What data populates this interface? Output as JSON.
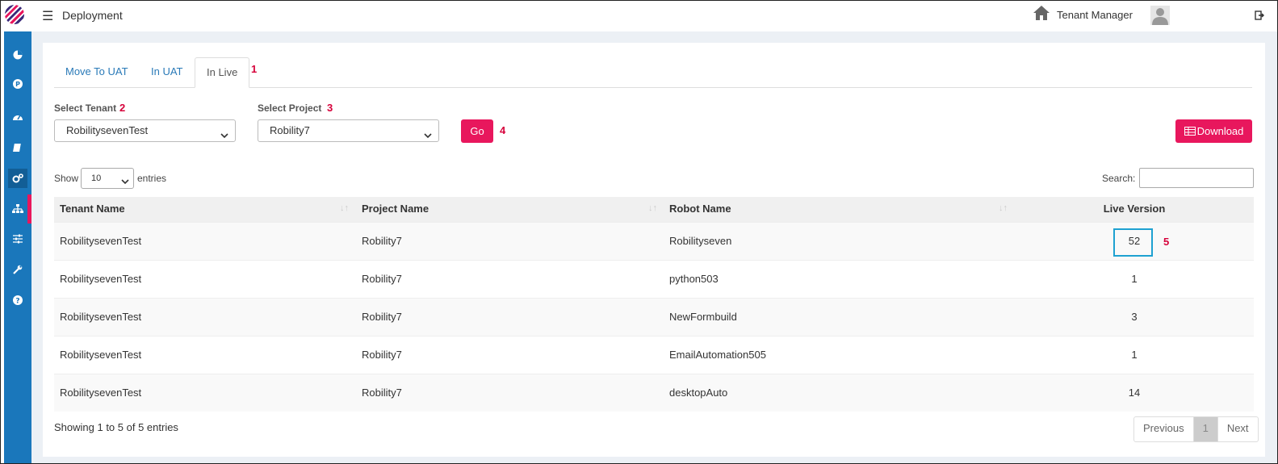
{
  "header": {
    "title": "Deployment",
    "tenant_manager": "Tenant Manager"
  },
  "sidebar": {
    "items": [
      {
        "icon": "pie-chart-icon"
      },
      {
        "icon": "p-circle-icon"
      },
      {
        "icon": "dashboard-gauge-icon"
      },
      {
        "icon": "book-icon"
      },
      {
        "icon": "gears-icon"
      },
      {
        "icon": "sitemap-icon"
      },
      {
        "icon": "sliders-icon"
      },
      {
        "icon": "wrench-icon"
      },
      {
        "icon": "help-icon"
      }
    ],
    "active_color": "#e8175d",
    "bg_color": "#1a77bb"
  },
  "tabs": [
    {
      "label": "Move To UAT"
    },
    {
      "label": "In UAT"
    },
    {
      "label": "In Live"
    }
  ],
  "annotations": [
    "1",
    "2",
    "3",
    "4",
    "5"
  ],
  "filters": {
    "tenant_label": "Select Tenant",
    "tenant_value": "RobilitysevenTest",
    "project_label": "Select Project",
    "project_value": "Robility7",
    "go_label": "Go",
    "download_label": "Download"
  },
  "table_controls": {
    "show_label": "Show",
    "entries_label": "entries",
    "page_length": "10",
    "search_label": "Search:"
  },
  "table": {
    "columns": [
      "Tenant Name",
      "Project Name",
      "Robot Name",
      "Live Version"
    ],
    "rows": [
      [
        "RobilitysevenTest",
        "Robility7",
        "Robilityseven",
        "52"
      ],
      [
        "RobilitysevenTest",
        "Robility7",
        "python503",
        "1"
      ],
      [
        "RobilitysevenTest",
        "Robility7",
        "NewFormbuild",
        "3"
      ],
      [
        "RobilitysevenTest",
        "Robility7",
        "EmailAutomation505",
        "1"
      ],
      [
        "RobilitysevenTest",
        "Robility7",
        "desktopAuto",
        "14"
      ]
    ]
  },
  "footer": {
    "info": "Showing 1 to 5 of 5 entries",
    "previous": "Previous",
    "page": "1",
    "next": "Next"
  },
  "colors": {
    "accent": "#e8175d",
    "link": "#2a7ab8",
    "highlight_box": "#1ea1d1"
  }
}
